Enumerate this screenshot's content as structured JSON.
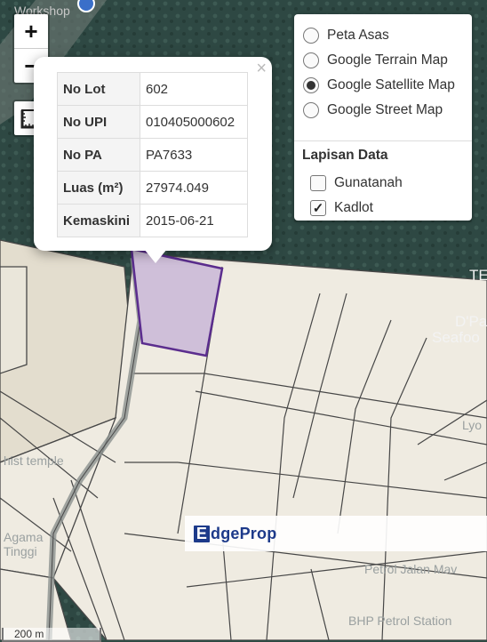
{
  "map": {
    "labels": {
      "workshop": "Workshop",
      "temple": "hist temple",
      "agama": "Agama",
      "tinggi": "Tinggi",
      "petrol": "Petrol Jalan Mav",
      "bhp": "BHP Petrol Station",
      "lyo": "Lyo",
      "te": "TE",
      "dpa": "D'Pa",
      "seafood": "Seafoo"
    },
    "colors": {
      "parcel": "#efebe1",
      "parcel_border": "#474747",
      "selected_fill": "#cfbfd9",
      "selected_border": "#5b2d8e"
    }
  },
  "controls": {
    "zoom_in": "+",
    "zoom_out": "−",
    "measure_icon": "ruler-icon"
  },
  "popup": {
    "close": "×",
    "rows": [
      {
        "key": "No Lot",
        "value": "602"
      },
      {
        "key": "No UPI",
        "value": "010405000602"
      },
      {
        "key": "No PA",
        "value": "PA7633"
      },
      {
        "key": "Luas (m²)",
        "value": "27974.049"
      },
      {
        "key": "Kemaskini",
        "value": "2015-06-21"
      }
    ]
  },
  "layers": {
    "base": [
      {
        "label": "Peta Asas",
        "selected": false
      },
      {
        "label": "Google Terrain Map",
        "selected": false
      },
      {
        "label": "Google Satellite Map",
        "selected": true
      },
      {
        "label": "Google Street Map",
        "selected": false
      }
    ],
    "data_heading": "Lapisan Data",
    "data": [
      {
        "label": "Gunatanah",
        "checked": false
      },
      {
        "label": "Kadlot",
        "checked": true
      }
    ]
  },
  "scale": "200 m",
  "brand": {
    "e": "E",
    "name": "dgeProp"
  }
}
